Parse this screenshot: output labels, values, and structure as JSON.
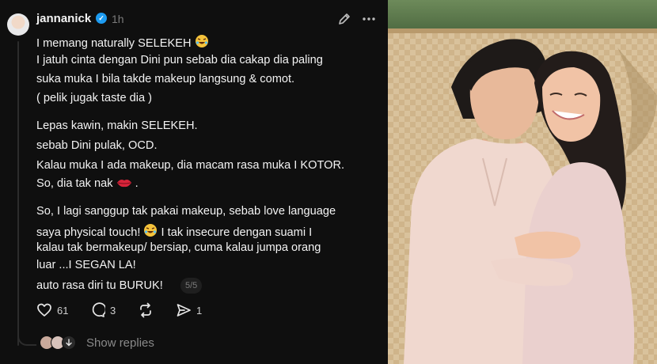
{
  "post": {
    "username": "jannanick",
    "time": "1h",
    "lines": [
      "I memang naturally SELEKEH",
      "I jatuh cinta dengan Dini pun sebab dia cakap dia paling",
      "suka muka I bila takde makeup langsung & comot.",
      "( pelik jugak taste dia )",
      "Lepas kawin, makin SELEKEH.",
      "sebab Dini  pulak, OCD.",
      "Kalau muka I ada makeup, dia macam rasa muka I KOTOR.",
      "So, dia tak nak",
      ".",
      "So, I lagi sanggup tak pakai makeup, sebab love language",
      "saya physical touch!",
      "I tak insecure dengan suami I",
      "kalau tak bermakeup/ bersiap, cuma kalau jumpa orang",
      "luar ...I SEGAN LA!",
      "auto rasa diri tu BURUK!"
    ],
    "page_indicator": "5/5",
    "likes": "61",
    "comments": "3",
    "shares": "1",
    "show_replies": "Show replies"
  },
  "icons": {
    "verified": "verified-badge-icon",
    "edit": "pencil-icon",
    "more": "more-icon",
    "like": "heart-icon",
    "comment": "comment-icon",
    "repost": "repost-icon",
    "share": "send-icon",
    "emoji_laugh": "rolling-laughing-emoji",
    "emoji_lips": "lips-emoji"
  },
  "colors": {
    "background": "#0f0f0f",
    "text": "#f3f3f3",
    "muted": "#7a7a7a",
    "verified": "#1d9bf0"
  }
}
